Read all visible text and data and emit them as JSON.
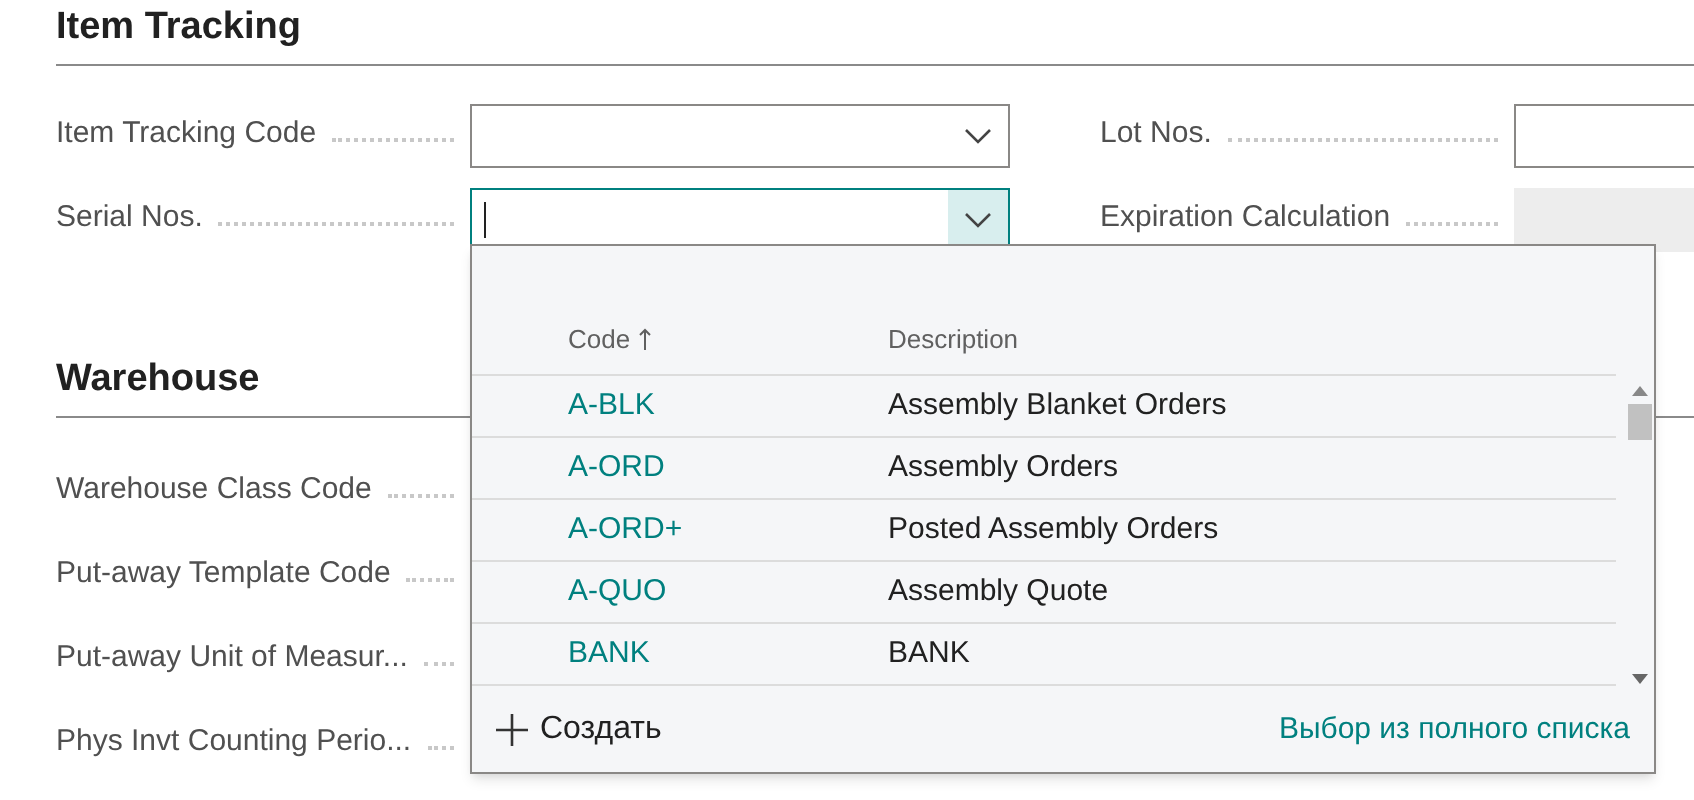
{
  "sections": [
    {
      "title": "Item Tracking",
      "fields": [
        {
          "label": "Item Tracking Code",
          "has_dropdown": true,
          "focused": false,
          "disabled": false
        },
        {
          "label": "Serial Nos.",
          "has_dropdown": true,
          "focused": true,
          "disabled": false
        }
      ],
      "right_fields": [
        {
          "label": "Lot Nos.",
          "has_dropdown": false,
          "focused": false,
          "disabled": false
        },
        {
          "label": "Expiration Calculation",
          "has_dropdown": false,
          "focused": false,
          "disabled": true
        }
      ]
    },
    {
      "title": "Warehouse",
      "labels": [
        "Warehouse Class Code",
        "Put-away Template Code",
        "Put-away Unit of Measur...",
        "Phys Invt Counting Perio..."
      ]
    }
  ],
  "lookup": {
    "columns": [
      {
        "label": "Code",
        "sorted": true
      },
      {
        "label": "Description",
        "sorted": false
      }
    ],
    "rows": [
      {
        "code": "A-BLK",
        "description": "Assembly Blanket Orders"
      },
      {
        "code": "A-ORD",
        "description": "Assembly Orders"
      },
      {
        "code": "A-ORD+",
        "description": "Posted Assembly Orders"
      },
      {
        "code": "A-QUO",
        "description": "Assembly Quote"
      },
      {
        "code": "BANK",
        "description": "BANK"
      }
    ],
    "new_button": "Создать",
    "full_list_link": "Выбор из полного списка"
  }
}
